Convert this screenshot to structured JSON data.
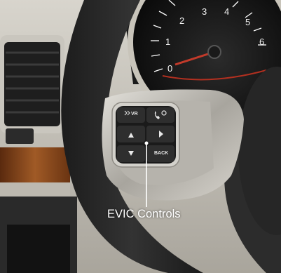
{
  "image": {
    "caption": "EVIC Controls",
    "gauge_numbers": [
      "0",
      "1",
      "2",
      "3",
      "4",
      "5",
      "6"
    ],
    "buttons": {
      "voice": "VR",
      "back": "BACK",
      "up_icon": "arrow-up-icon",
      "down_icon": "arrow-down-icon",
      "right_icon": "arrow-right-icon",
      "phone_icon": "phone-icon"
    }
  },
  "colors": {
    "wheel": "#2a2a2a",
    "trim": "#b9b7b0",
    "dash": "#cfccc4",
    "wood": "#8a4a1e"
  }
}
